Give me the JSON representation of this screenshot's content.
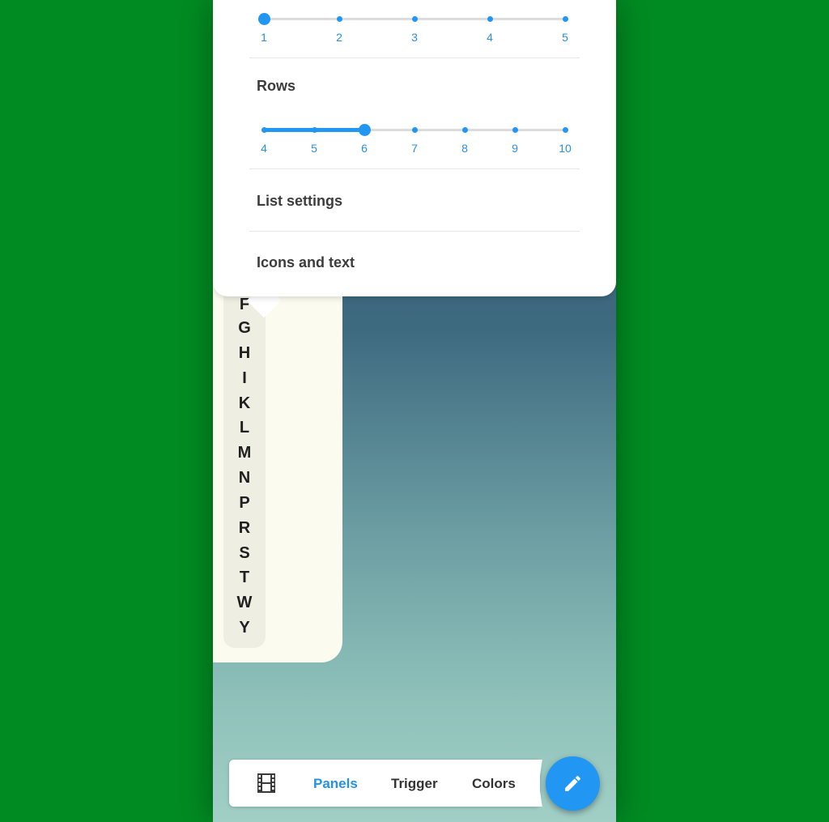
{
  "columns_slider": {
    "labels": [
      "1",
      "2",
      "3",
      "4",
      "5"
    ],
    "selected_index": 0
  },
  "rows_section": {
    "title": "Rows",
    "labels": [
      "4",
      "5",
      "6",
      "7",
      "8",
      "9",
      "10"
    ],
    "selected_index": 2
  },
  "menu": {
    "list_settings": "List settings",
    "icons_and_text": "Icons and text"
  },
  "letters": [
    "F",
    "G",
    "H",
    "I",
    "K",
    "L",
    "M",
    "N",
    "P",
    "R",
    "S",
    "T",
    "W",
    "Y"
  ],
  "bottom_nav": {
    "film_icon": "film-strip-icon",
    "tabs": [
      {
        "label": "Panels",
        "active": true
      },
      {
        "label": "Trigger",
        "active": false
      },
      {
        "label": "Colors",
        "active": false
      }
    ]
  },
  "fab": {
    "icon": "pencil-icon"
  },
  "colors": {
    "background": "#008b22",
    "accent": "#2196f3",
    "panel": "#fbfbf0",
    "text": "#3c3c3c"
  }
}
